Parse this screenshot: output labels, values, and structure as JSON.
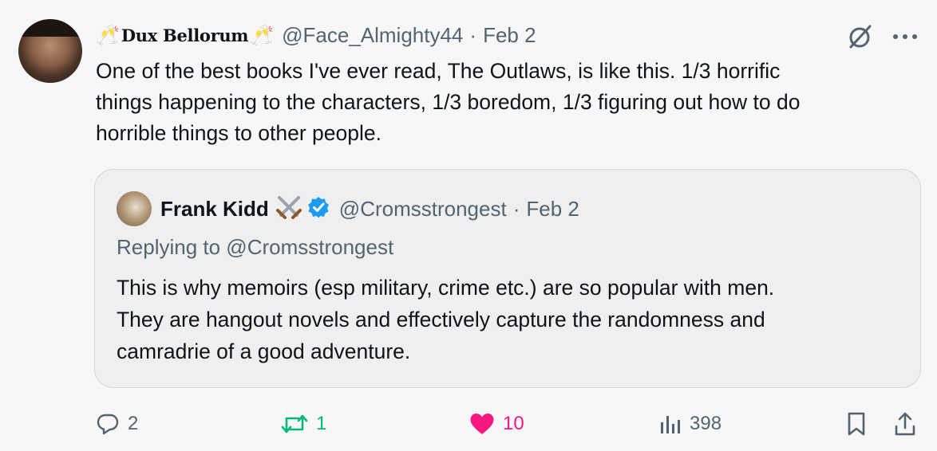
{
  "tweet": {
    "author": {
      "emoji_left": "🥂",
      "display_name": "Dux Bellorum",
      "emoji_right": "🥂",
      "handle": "@Face_Almighty44",
      "separator": "·",
      "date": "Feb 2"
    },
    "text_lines": [
      "One of the best books I've ever read, The Outlaws, is like this. 1/3 horrific",
      "things happening to the characters, 1/3 boredom, 1/3 figuring out how to do",
      "horrible things to other people."
    ],
    "top_icons": [
      "grok-icon",
      "more-icon"
    ],
    "more_label": "···"
  },
  "quote": {
    "author": {
      "display_name": "Frank Kidd",
      "emoji": "⚔️",
      "verified": true,
      "handle": "@Cromsstrongest",
      "separator": "·",
      "date": "Feb 2"
    },
    "replying_to": "Replying to @Cromsstrongest",
    "text_lines": [
      "This is why memoirs (esp military, crime etc.) are so popular with men.",
      "They are hangout novels and effectively capture the randomness and",
      "camradrie of a good adventure."
    ]
  },
  "actions": {
    "replies": "2",
    "reposts": "1",
    "likes": "10",
    "views": "398",
    "colors": {
      "repost": "#00ba7c",
      "like": "#f91880",
      "muted": "#536471",
      "verified": "#1d9bf0"
    }
  }
}
